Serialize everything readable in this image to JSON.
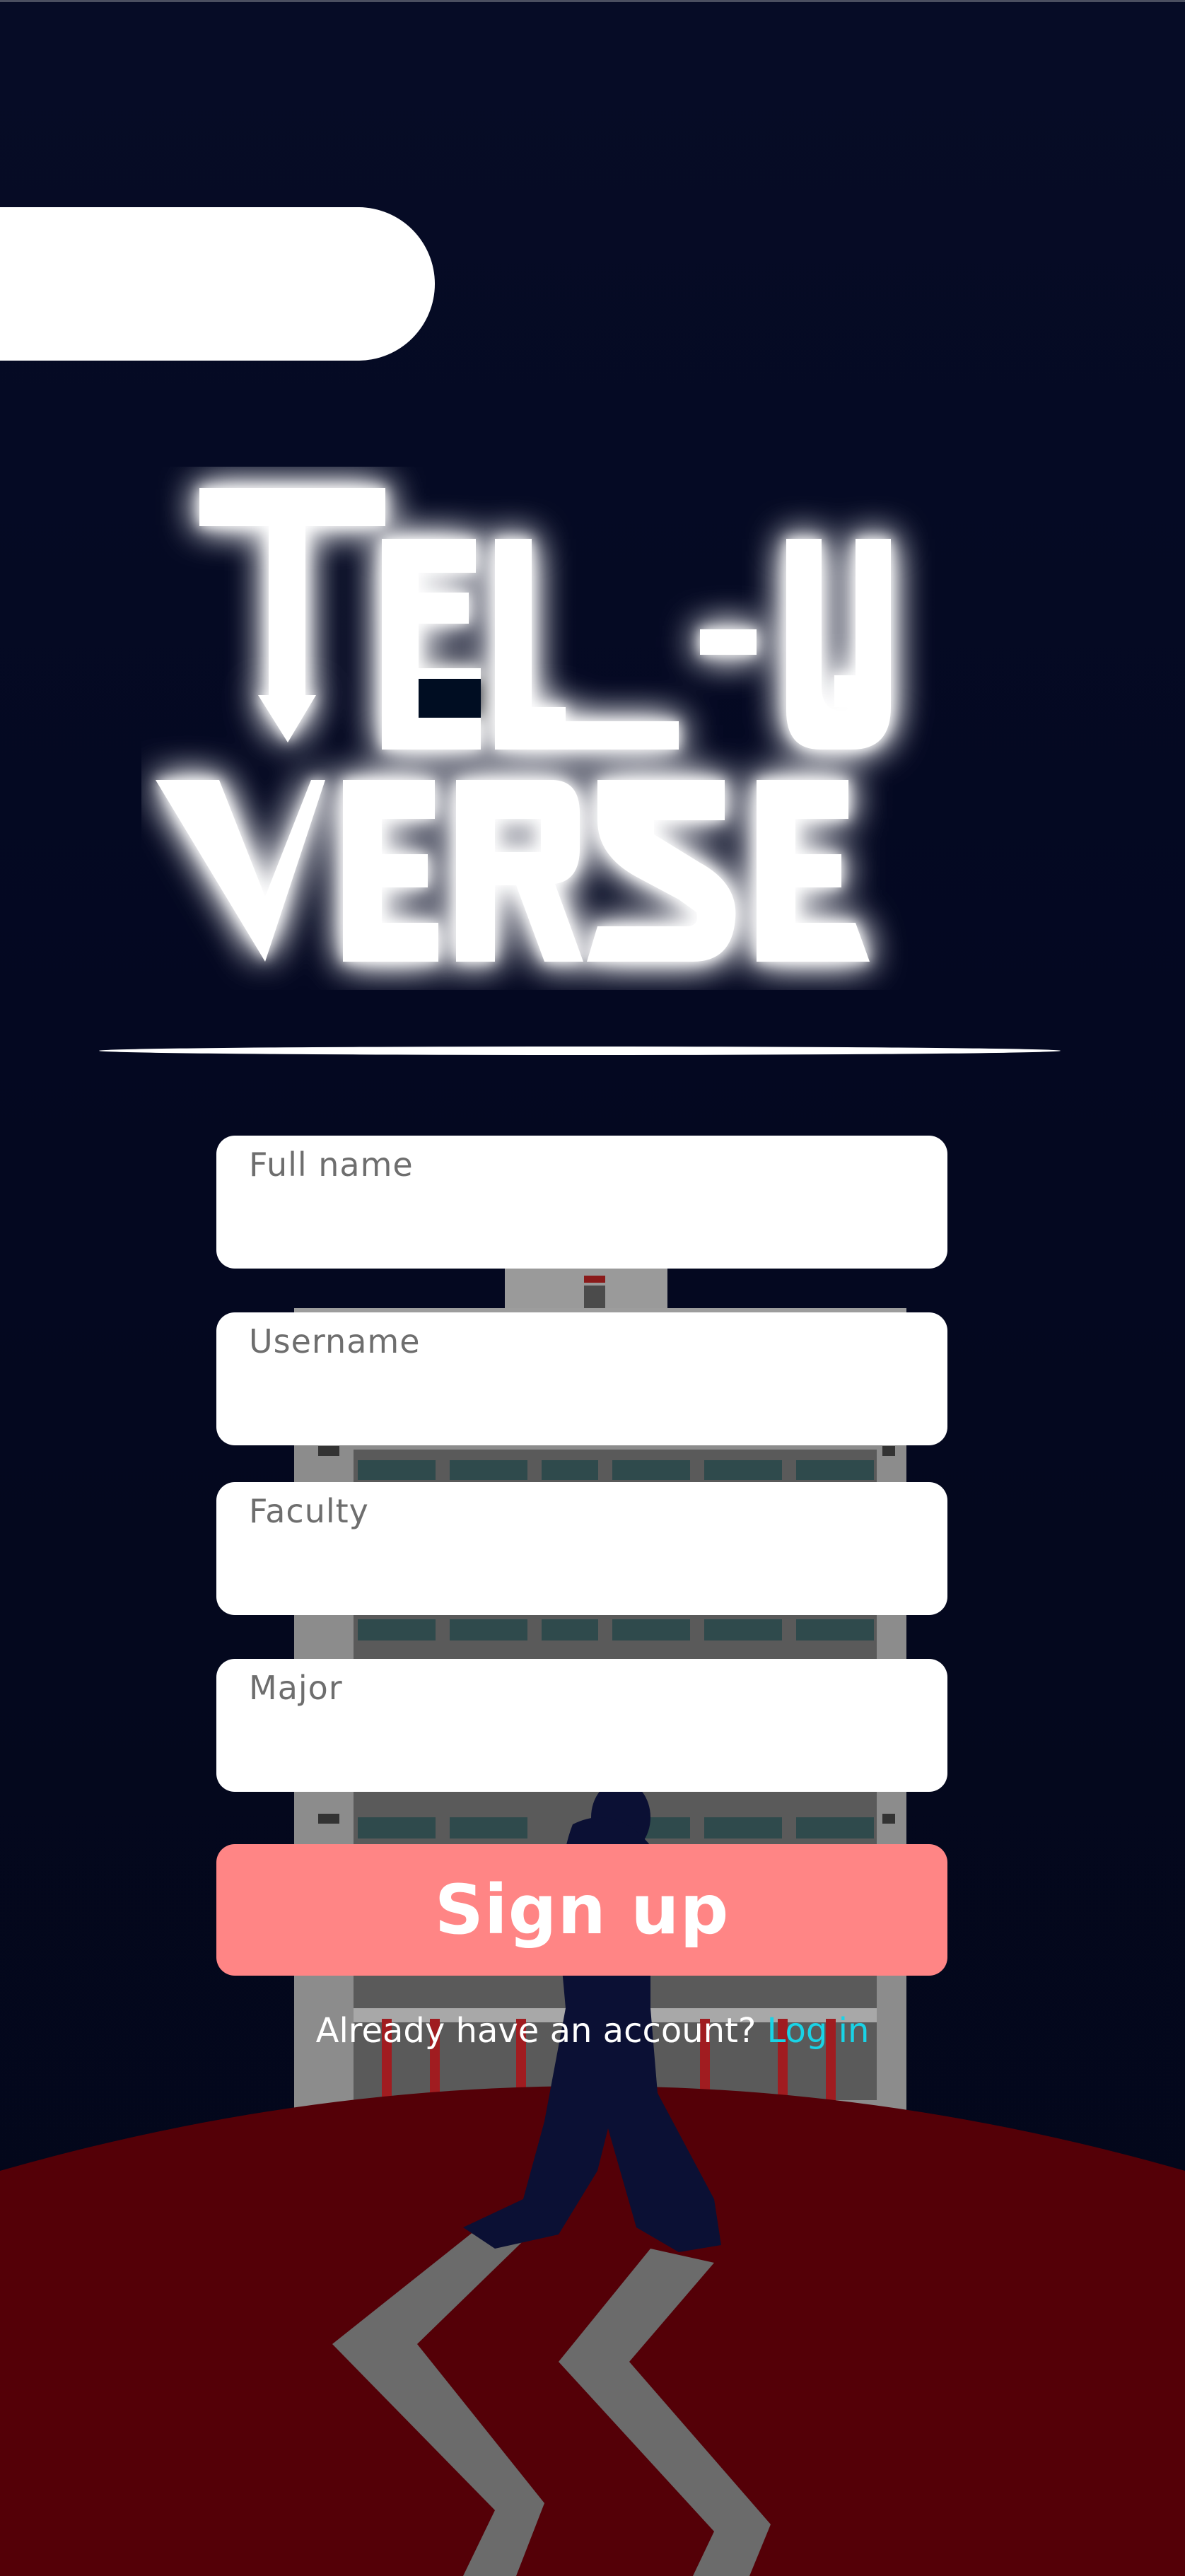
{
  "brand": {
    "line1": "TEL-U",
    "line2": "VERSE"
  },
  "form": {
    "fields": [
      {
        "placeholder": "Full name"
      },
      {
        "placeholder": "Username"
      },
      {
        "placeholder": "Faculty"
      },
      {
        "placeholder": "Major"
      }
    ],
    "submit_label": "Sign up",
    "prompt_text": "Already have an account?",
    "login_link": "Log in"
  },
  "colors": {
    "background": "#040820",
    "button": "#ff8585",
    "link": "#19d3e6",
    "ground": "#540007"
  }
}
